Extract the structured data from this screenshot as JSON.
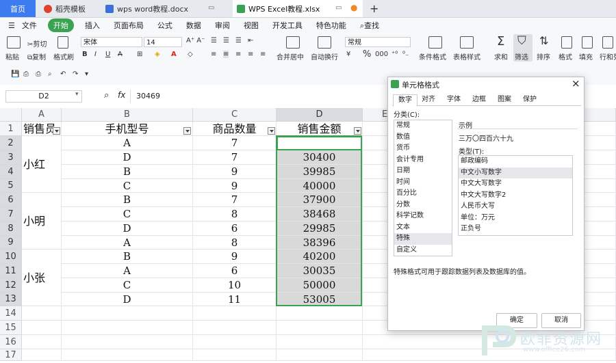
{
  "tabs": {
    "home": "首页",
    "t1": "稻壳模板",
    "t2": "wps word教程.docx",
    "t3": "WPS Excel教程.xlsx",
    "add": "+"
  },
  "menu": {
    "file": "文件",
    "start": "开始",
    "items": [
      "插入",
      "页面布局",
      "公式",
      "数据",
      "审阅",
      "视图",
      "开发工具",
      "特色功能"
    ],
    "search": "查找"
  },
  "ribbon": {
    "paste": "粘贴",
    "cut": "剪切",
    "copy": "复制",
    "format_painter": "格式刷",
    "font": "宋体",
    "size": "14",
    "merge": "合并居中",
    "wrap": "自动换行",
    "numfmt": "常规",
    "pct": "%",
    "thousands": "000",
    "cond": "条件格式",
    "table_style": "表格样式",
    "sum": "求和",
    "filter": "筛选",
    "sort": "排序",
    "format": "格式",
    "fill": "填充",
    "rowcol": "行和列"
  },
  "formula": {
    "namebox": "D2",
    "fx": "fx",
    "value": "30469"
  },
  "columns": [
    "A",
    "B",
    "C",
    "D",
    "E"
  ],
  "rows": [
    "1",
    "2",
    "3",
    "4",
    "5",
    "6",
    "7",
    "8",
    "9",
    "10",
    "11",
    "12",
    "13",
    "14",
    "15",
    "16",
    "17"
  ],
  "headers": [
    "销售员",
    "手机型号",
    "商品数量",
    "销售金额"
  ],
  "data": [
    {
      "model": "A",
      "qty": "7",
      "amount": "30469"
    },
    {
      "model": "D",
      "qty": "7",
      "amount": "30400"
    },
    {
      "model": "B",
      "qty": "9",
      "amount": "39985"
    },
    {
      "model": "C",
      "qty": "9",
      "amount": "40000"
    },
    {
      "model": "B",
      "qty": "7",
      "amount": "37900"
    },
    {
      "model": "C",
      "qty": "8",
      "amount": "38468"
    },
    {
      "model": "D",
      "qty": "6",
      "amount": "29985"
    },
    {
      "model": "A",
      "qty": "8",
      "amount": "38396"
    },
    {
      "model": "B",
      "qty": "9",
      "amount": "40200"
    },
    {
      "model": "A",
      "qty": "6",
      "amount": "30035"
    },
    {
      "model": "C",
      "qty": "10",
      "amount": "50000"
    },
    {
      "model": "D",
      "qty": "11",
      "amount": "53005"
    }
  ],
  "salespeople": [
    "小红",
    "小明",
    "小张"
  ],
  "dialog": {
    "title": "单元格格式",
    "close": "×",
    "tabs": [
      "数字",
      "对齐",
      "字体",
      "边框",
      "图案",
      "保护"
    ],
    "category_label": "分类(C):",
    "categories": [
      "常规",
      "数值",
      "货币",
      "会计专用",
      "日期",
      "时间",
      "百分比",
      "分数",
      "科学记数",
      "文本",
      "特殊",
      "自定义"
    ],
    "selected_category": "特殊",
    "sample_label": "示例",
    "sample_value": "三万〇四百六十九",
    "type_label": "类型(T):",
    "types": [
      "邮政编码",
      "中文小写数字",
      "中文大写数字",
      "中文大写数字2",
      "人民币大写",
      "单位：万元",
      "正负号"
    ],
    "selected_type": "中文小写数字",
    "description": "特殊格式可用于跟踪数据列表及数据库的值。",
    "ok": "确定",
    "cancel": "取消"
  },
  "watermark": {
    "text": "欧菲资源网",
    "url": "www.office26.com"
  },
  "colors": {
    "accent": "#3aa352",
    "home_tab": "#3c7cf0",
    "selection": "#d9d9d9"
  }
}
